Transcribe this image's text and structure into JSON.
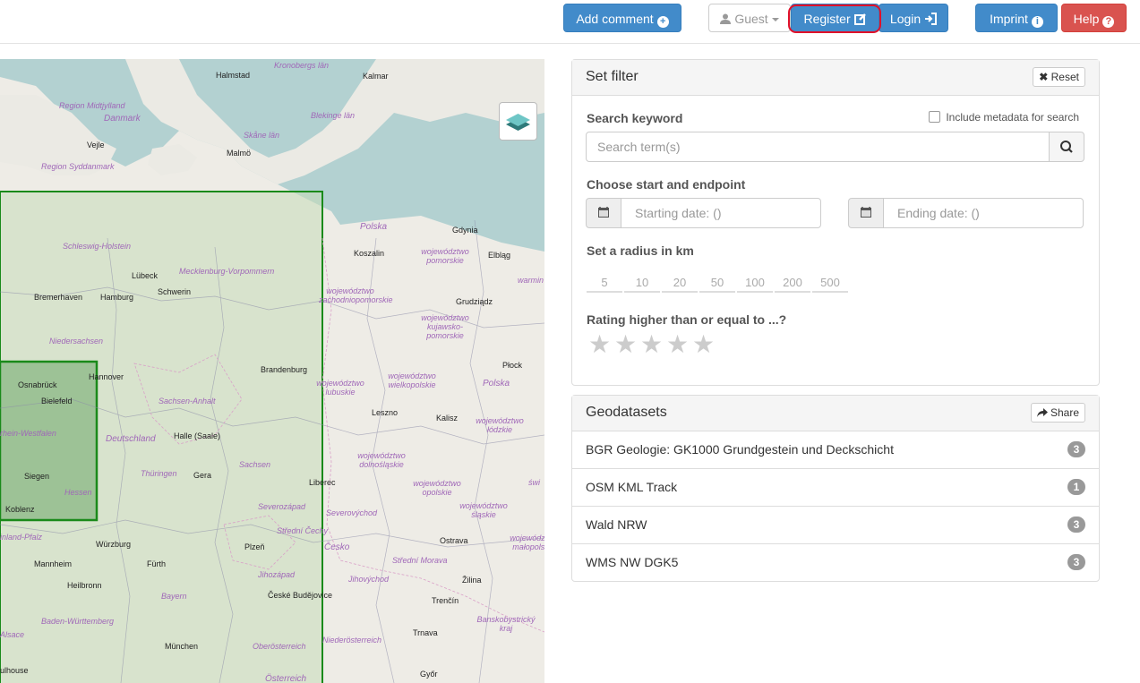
{
  "topbar": {
    "add_comment": "Add comment",
    "guest": "Guest",
    "register": "Register",
    "login": "Login",
    "imprint": "Imprint",
    "help": "Help"
  },
  "map": {
    "labels": {
      "kronobergs_lan": "Kronobergs län",
      "halmstad": "Halmstad",
      "kalmar": "Kalmar",
      "region_midtjylland": "Region Midtjylland",
      "danmark": "Danmark",
      "blekinge_lan": "Blekinge län",
      "skane_lan": "Skåne län",
      "vejle": "Vejle",
      "malmo": "Malmö",
      "region_syddanmark": "Region Syddanmark",
      "polska": "Polska",
      "gdynia": "Gdynia",
      "schleswig_holstein": "Schleswig-Holstein",
      "koszalin": "Koszalin",
      "woj_pomorskie": "województwo pomorskie",
      "elblag": "Elbląg",
      "lubeck": "Lübeck",
      "mecklenburg": "Mecklenburg-Vorpommern",
      "warmin": "warmin",
      "bremerhaven": "Bremerhaven",
      "hamburg": "Hamburg",
      "schwerin": "Schwerin",
      "woj_zachodniopomorskie": "województwo zachodniopomorskie",
      "grudziadz": "Grudziądz",
      "niedersachsen": "Niedersachsen",
      "woj_kujawsko": "województwo kujawsko-pomorskie",
      "brandenburg": "Brandenburg",
      "plock": "Płock",
      "osnabruck": "Osnabrück",
      "hannover": "Hannover",
      "woj_wielkopolskie": "województwo wielkopolskie",
      "bielefeld": "Bielefeld",
      "woj_lubuskie": "województwo lubuskie",
      "sachsen_anhalt": "Sachsen-Anhalt",
      "leszno": "Leszno",
      "kalisz": "Kalisz",
      "woj_lodzkie": "województwo łódzkie",
      "nordrhein_westfalen": "rhein-Westfalen",
      "deutschland": "Deutschland",
      "halle": "Halle (Saale)",
      "sachsen": "Sachsen",
      "woj_dolnoslaskie": "województwo dolnośląskie",
      "siegen": "Siegen",
      "thuringen": "Thüringen",
      "gera": "Gera",
      "liberec": "Liberec",
      "woj_opolskie": "województwo opolskie",
      "hessen": "Hessen",
      "severozapad": "Severozápad",
      "severovychod": "Severovýchod",
      "woj_slaskie": "województwo śląskie",
      "koblenz": "Koblenz",
      "rheinland_pfalz": "inland-Pfalz",
      "stredni_cechy": "Střední Čechy",
      "cesko": "Česko",
      "ostrava": "Ostrava",
      "woj_malopolskie": "województwo małopolskie",
      "wurzburg": "Würzburg",
      "plzen": "Plzeň",
      "stredni_morava": "Střední Morava",
      "mannheim": "Mannheim",
      "furth": "Fürth",
      "jihozapad": "Jihozápad",
      "jihovychod": "Jihovýchod",
      "zilina": "Žilina",
      "heilbronn": "Heilbronn",
      "bayern": "Bayern",
      "ceske_budejovice": "České Budějovice",
      "trencin": "Trenčín",
      "baden_wurttemberg": "Baden-Württemberg",
      "banskobystricky": "Banskobystrický kraj",
      "alsace": "Alsace",
      "munchen": "München",
      "oberosterreich": "Oberösterreich",
      "niederosterreich": "Niederösterreich",
      "trnava": "Trnava",
      "mulhouse": "ulhouse",
      "osterreich": "Österreich",
      "gyor": "Győr",
      "swie": "świ"
    }
  },
  "filter": {
    "title": "Set filter",
    "reset": "Reset",
    "search_label": "Search keyword",
    "metadata_label": "Include metadata for search",
    "search_placeholder": "Search term(s)",
    "date_label": "Choose start and endpoint",
    "start_placeholder": "Starting date: ()",
    "end_placeholder": "Ending date: ()",
    "radius_label": "Set a radius in km",
    "radii": [
      "5",
      "10",
      "20",
      "50",
      "100",
      "200",
      "500"
    ],
    "rating_label": "Rating higher than or equal to ...?"
  },
  "geodatasets": {
    "title": "Geodatasets",
    "share": "Share",
    "items": [
      {
        "name": "BGR Geologie: GK1000 Grundgestein und Deckschicht",
        "count": "3"
      },
      {
        "name": "OSM KML Track",
        "count": "1"
      },
      {
        "name": "Wald NRW",
        "count": "3"
      },
      {
        "name": "WMS NW DGK5",
        "count": "3"
      }
    ]
  }
}
